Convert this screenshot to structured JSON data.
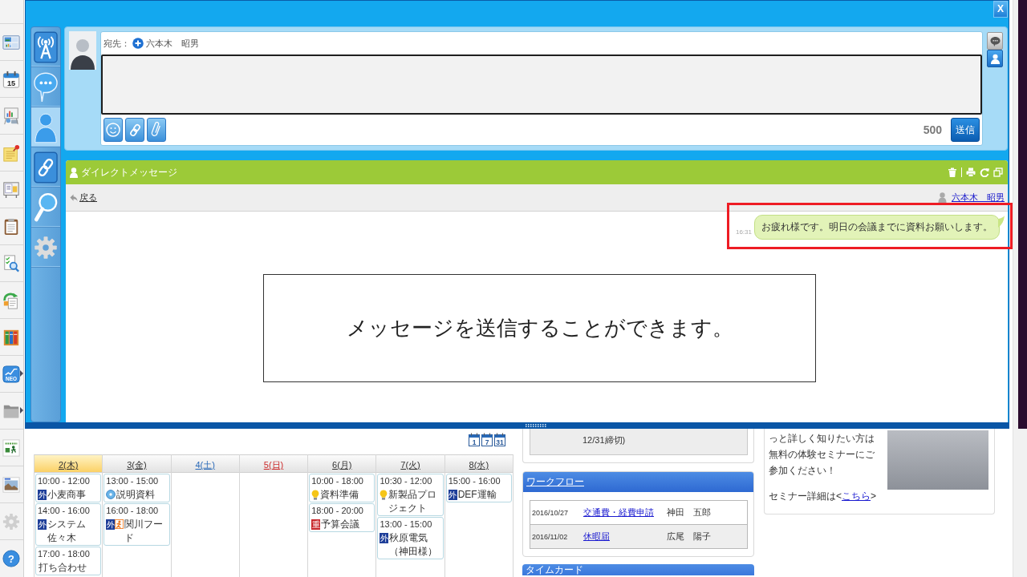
{
  "dock": {
    "items": [
      {
        "kind": "dashboard",
        "submenu": false
      },
      {
        "kind": "calendar",
        "label": "15",
        "submenu": false
      },
      {
        "kind": "presentation",
        "submenu": false
      },
      {
        "kind": "sticky_note",
        "submenu": false
      },
      {
        "kind": "board",
        "submenu": false
      },
      {
        "kind": "clipboard",
        "submenu": false
      },
      {
        "kind": "document_search",
        "submenu": false
      },
      {
        "kind": "document_cycle",
        "submenu": false
      },
      {
        "kind": "binders",
        "submenu": false
      },
      {
        "kind": "chart",
        "label": "NEO",
        "submenu": true
      },
      {
        "kind": "folder",
        "submenu": true
      },
      {
        "kind": "logo_tile",
        "submenu": false
      },
      {
        "kind": "photo_tile",
        "submenu": false
      },
      {
        "kind": "gear",
        "submenu": false
      },
      {
        "kind": "help",
        "label": "?",
        "submenu": false
      }
    ]
  },
  "modal": {
    "close_label": "X",
    "nav": [
      {
        "kind": "broadcast",
        "selected": false
      },
      {
        "kind": "chat",
        "selected": false
      },
      {
        "kind": "person",
        "selected": true
      },
      {
        "kind": "link",
        "selected": false
      },
      {
        "kind": "search",
        "selected": false
      },
      {
        "kind": "settings",
        "selected": false
      }
    ],
    "composer": {
      "to_label": "宛先：",
      "recipient": "六本木　昭男",
      "tools": [
        {
          "kind": "emoji"
        },
        {
          "kind": "link"
        },
        {
          "kind": "attach"
        }
      ],
      "char_count": "500",
      "send_label": "送信",
      "side_buttons": [
        {
          "kind": "chat",
          "selected": false
        },
        {
          "kind": "person",
          "selected": true
        }
      ]
    },
    "direct_messages": {
      "title": "ダイレクトメッセージ",
      "actions": [
        {
          "kind": "delete"
        },
        {
          "kind": "print"
        },
        {
          "kind": "refresh"
        },
        {
          "kind": "restore"
        }
      ],
      "back_label": "戻る",
      "partner": "六本木　昭男",
      "messages": [
        {
          "time": "16:31",
          "text": "お疲れ様です。明日の会議までに資料お願いします。",
          "outgoing": true
        }
      ]
    }
  },
  "callout": {
    "text": "メッセージを送信することができます。"
  },
  "calendar": {
    "view_buttons": [
      {
        "label": "1"
      },
      {
        "label": "7"
      },
      {
        "label": "31"
      }
    ],
    "days": [
      {
        "label": "2(木)",
        "today": true,
        "color": "#333333",
        "events": [
          {
            "time": "10:00 - 12:00",
            "title": "小麦商事",
            "icons": [
              {
                "kind": "badge",
                "label": "外",
                "color": "#1f3f99"
              }
            ]
          },
          {
            "time": "14:00 - 16:00",
            "title": "システム佐々木",
            "icons": [
              {
                "kind": "badge",
                "label": "外",
                "color": "#1f3f99"
              }
            ]
          },
          {
            "time": "17:00 - 18:00",
            "title": "打ち合わせ"
          }
        ]
      },
      {
        "label": "3(金)",
        "today": false,
        "color": "#333333",
        "events": [
          {
            "time": "13:00 - 15:00",
            "title": "説明資料",
            "icons": [
              {
                "kind": "disc"
              }
            ]
          },
          {
            "time": "16:00 - 18:00",
            "title": "関川フード",
            "icons": [
              {
                "kind": "badge",
                "label": "外",
                "color": "#1f3f99"
              },
              {
                "kind": "figure"
              }
            ]
          }
        ]
      },
      {
        "label": "4(土)",
        "today": false,
        "color": "#2a6ab8"
      },
      {
        "label": "5(日)",
        "today": false,
        "color": "#cc2a2a"
      },
      {
        "label": "6(月)",
        "today": false,
        "color": "#333333",
        "events": [
          {
            "time": "10:00 - 18:00",
            "title": "資料準備",
            "icons": [
              {
                "kind": "bulb"
              }
            ]
          },
          {
            "time": "18:00 - 20:00",
            "title": "予算会議",
            "icons": [
              {
                "kind": "badge",
                "label": "重",
                "color": "#c8282d"
              }
            ]
          }
        ]
      },
      {
        "label": "7(火)",
        "today": false,
        "color": "#333333",
        "events": [
          {
            "time": "10:30 - 12:00",
            "title": "新製品プロジェクト",
            "icons": [
              {
                "kind": "bulb"
              }
            ]
          },
          {
            "time": "13:00 - 15:00",
            "title": "秋原電気（神田様）",
            "icons": [
              {
                "kind": "badge",
                "label": "外",
                "color": "#1f3f99"
              }
            ]
          }
        ]
      },
      {
        "label": "8(水)",
        "today": false,
        "color": "#333333",
        "events": [
          {
            "time": "15:00 - 16:00",
            "title": "DEF運輸",
            "icons": [
              {
                "kind": "badge",
                "label": "外",
                "color": "#1f3f99"
              }
            ]
          }
        ]
      }
    ]
  },
  "deadline_note": "12/31締切)",
  "workflow": {
    "title": "ワークフロー",
    "rows": [
      {
        "date": "2016/10/27",
        "subject": "交通費・経費申請",
        "applicant": "神田　五郎"
      },
      {
        "date": "2016/11/02",
        "subject": "休暇届",
        "applicant": "広尾　陽子"
      }
    ]
  },
  "timecard": {
    "title": "タイムカード"
  },
  "seminar": {
    "text": "っと詳しく知りたい方は無料の体験セミナーにご参加ください！",
    "detail_prefix": "セミナー詳細は<",
    "detail_link": "こちら",
    "detail_suffix": ">"
  }
}
